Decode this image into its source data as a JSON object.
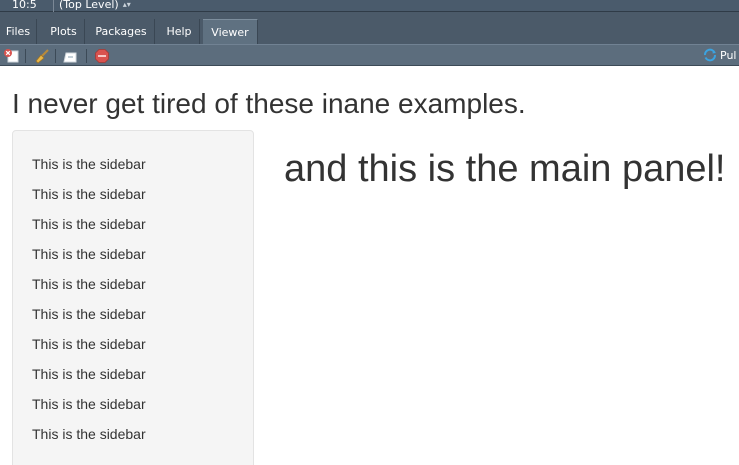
{
  "status": {
    "position": "10:5",
    "scope": "(Top Level)"
  },
  "tabs": [
    {
      "label": "Files",
      "active": false
    },
    {
      "label": "Plots",
      "active": false
    },
    {
      "label": "Packages",
      "active": false
    },
    {
      "label": "Help",
      "active": false
    },
    {
      "label": "Viewer",
      "active": true
    }
  ],
  "toolbar": {
    "remove_icon": "remove-viewer-icon",
    "clear_icon": "broom-icon",
    "export_icon": "export-icon",
    "stop_icon": "stop-icon",
    "publish_label": "Pul"
  },
  "viewer": {
    "title": "I never get tired of these inane examples.",
    "sidebar_items": [
      "This is the sidebar",
      "This is the sidebar",
      "This is the sidebar",
      "This is the sidebar",
      "This is the sidebar",
      "This is the sidebar",
      "This is the sidebar",
      "This is the sidebar",
      "This is the sidebar",
      "This is the sidebar"
    ],
    "main_text": "and this is the main panel!"
  },
  "colors": {
    "chrome": "#4b5a69",
    "toolbar": "#5c6d7d",
    "text": "#333333",
    "sidebar_bg": "#f5f5f5",
    "publish_accent": "#3ba3e0",
    "stop_red": "#d9534f"
  }
}
